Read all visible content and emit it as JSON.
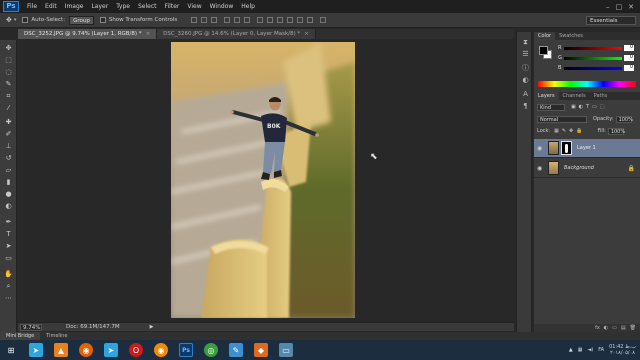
{
  "app": {
    "logo": "Ps",
    "menu": [
      "File",
      "Edit",
      "Image",
      "Layer",
      "Type",
      "Select",
      "Filter",
      "View",
      "Window",
      "Help"
    ],
    "window_controls": [
      "–",
      "□",
      "✕"
    ]
  },
  "options": {
    "auto_select_label": "Auto-Select:",
    "auto_select_value": "Group",
    "transform_label": "Show Transform Controls",
    "workspace": "Essentials"
  },
  "tabs": [
    {
      "label": "DSC_3252.JPG @ 9.74% (Layer 1, RGB/8) *",
      "close": "×",
      "active": true
    },
    {
      "label": "DSC_3260.JPG @ 14.6% (Layer 0, Layer Mask/8) *",
      "close": "×",
      "active": false
    }
  ],
  "status": {
    "zoom": "9.74%",
    "doc": "Doc: 69.1M/147.7M",
    "arrow": "▶"
  },
  "bottom_tabs": [
    "Mini Bridge",
    "Timeline"
  ],
  "color_panel": {
    "tabs": [
      "Color",
      "Swatches"
    ],
    "rows": [
      {
        "label": "R",
        "value": "0",
        "gradient": "linear-gradient(to right,#000,#f00)"
      },
      {
        "label": "G",
        "value": "0",
        "gradient": "linear-gradient(to right,#000,#0f0)"
      },
      {
        "label": "B",
        "value": "0",
        "gradient": "linear-gradient(to right,#000,#00f)"
      }
    ]
  },
  "layers_panel": {
    "tabs": [
      "Layers",
      "Channels",
      "Paths"
    ],
    "filter_kind": "Kind",
    "blend_mode": "Normal",
    "opacity_label": "Opacity:",
    "opacity_value": "100%",
    "lock_label": "Lock:",
    "fill_label": "Fill:",
    "fill_value": "100%",
    "layers": [
      {
        "name": "Layer 1",
        "selected": true
      },
      {
        "name": "Background",
        "selected": false
      }
    ],
    "footer_icons": [
      "fx",
      "◐",
      "▭",
      "▤",
      "🗑"
    ]
  },
  "taskbar": {
    "icons": [
      {
        "name": "start-icon",
        "color": "#3a7bd5",
        "glyph": "⊞"
      },
      {
        "name": "telegram-icon",
        "color": "#2ca5e0",
        "glyph": "➤"
      },
      {
        "name": "vlc-icon",
        "color": "#e8811e",
        "glyph": "▲"
      },
      {
        "name": "firefox-icon",
        "color": "#e66000",
        "glyph": "◉"
      },
      {
        "name": "telegram-icon-2",
        "color": "#2ca5e0",
        "glyph": "➤"
      },
      {
        "name": "opera-icon",
        "color": "#cc1b1b",
        "glyph": "O"
      },
      {
        "name": "firefox-icon-2",
        "color": "#f08a00",
        "glyph": "◉"
      },
      {
        "name": "photoshop-icon",
        "color": "#0b3b6b",
        "glyph": "Ps"
      },
      {
        "name": "chrome-icon",
        "color": "#3c9d3c",
        "glyph": "◎"
      },
      {
        "name": "notepad-icon",
        "color": "#3d8fd4",
        "glyph": "✎"
      },
      {
        "name": "app-orange-icon",
        "color": "#e06a1c",
        "glyph": "◆"
      },
      {
        "name": "monitor-icon",
        "color": "#5588aa",
        "glyph": "▭"
      }
    ],
    "tray_lang": "FA",
    "time": "01:42 ب.ظ",
    "date": "۲۰۱۸/۰۵/۰۸"
  }
}
